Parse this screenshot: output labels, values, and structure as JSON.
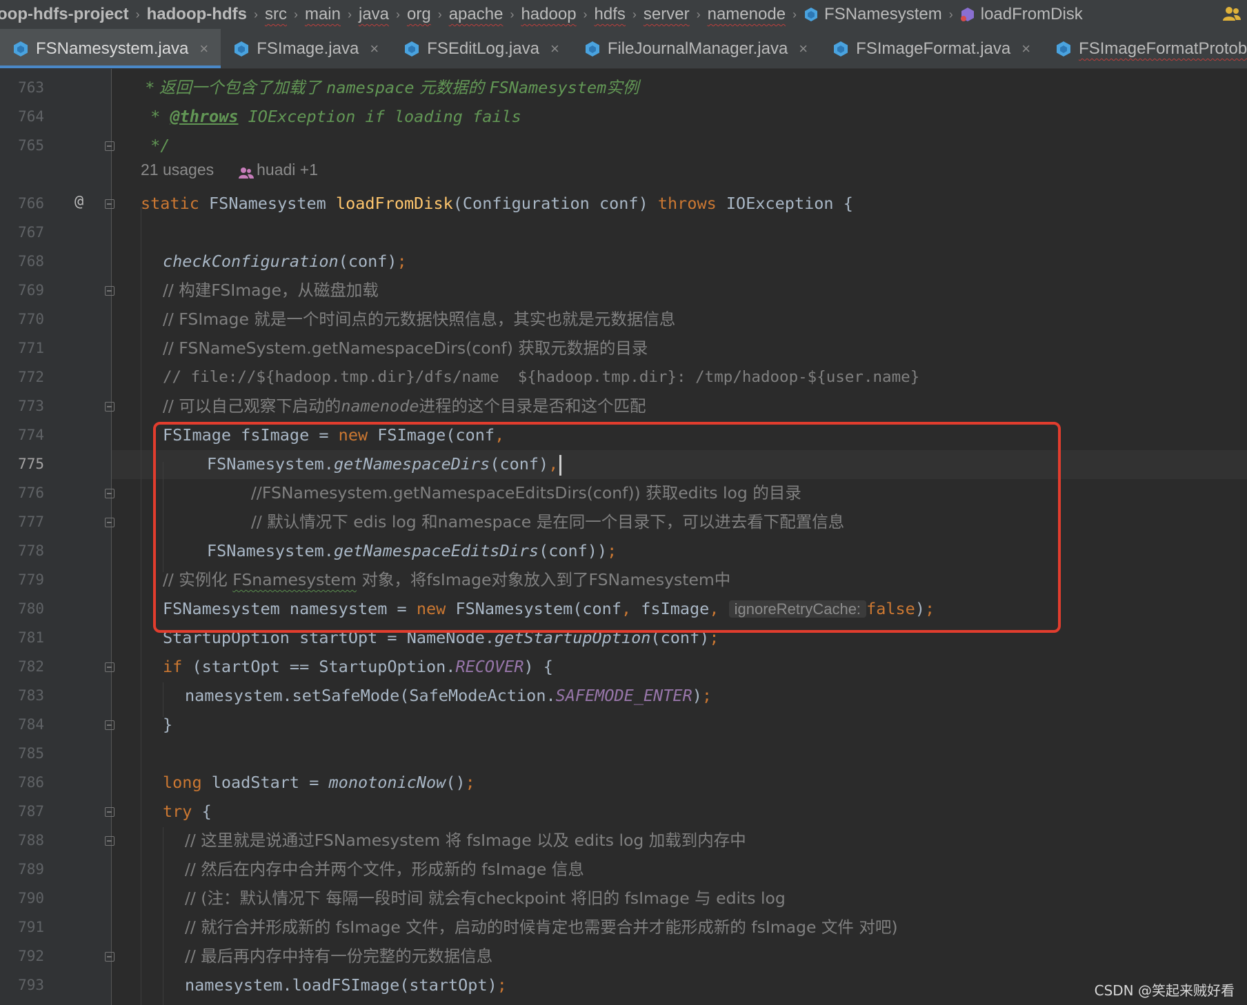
{
  "breadcrumb": {
    "items": [
      {
        "label": "oop-hdfs-project",
        "bold": true
      },
      {
        "label": "hadoop-hdfs",
        "bold": true
      },
      {
        "label": "src"
      },
      {
        "label": "main"
      },
      {
        "label": "java"
      },
      {
        "label": "org"
      },
      {
        "label": "apache"
      },
      {
        "label": "hadoop"
      },
      {
        "label": "hdfs"
      },
      {
        "label": "server"
      },
      {
        "label": "namenode"
      },
      {
        "label": "FSNamesystem",
        "icon": "class-icon"
      },
      {
        "label": "loadFromDisk",
        "icon": "method-icon"
      }
    ],
    "separator": "›"
  },
  "tabs": [
    {
      "label": "FSNamesystem.java",
      "active": true
    },
    {
      "label": "FSImage.java"
    },
    {
      "label": "FSEditLog.java"
    },
    {
      "label": "FileJournalManager.java"
    },
    {
      "label": "FSImageFormat.java"
    },
    {
      "label": "FSImageFormatProtobuf.ja"
    }
  ],
  "tab_close": "×",
  "editor": {
    "line_numbers": [
      "763",
      "764",
      "765",
      "766",
      "767",
      "768",
      "769",
      "770",
      "771",
      "772",
      "773",
      "774",
      "775",
      "776",
      "777",
      "778",
      "779",
      "780",
      "781",
      "782",
      "783",
      "784",
      "785",
      "786",
      "787",
      "788",
      "789",
      "790",
      "791",
      "792",
      "793"
    ],
    "current_line": "775",
    "gutter_annotation": "@",
    "usages": "21 usages",
    "authors": "huadi +1",
    "inlay_hint": "ignoreRetryCache:",
    "lines": {
      "l763_a": " * 返回一个包含了加载了 ",
      "l763_b": "namespace",
      "l763_c": " 元数据的 ",
      "l763_d": "FSNamesystem",
      "l763_e": "实例",
      "l764_a": " * ",
      "l764_tag": "@throws",
      "l764_b": " IOException if loading fails",
      "l765": " */",
      "l766_kw1": "static",
      "l766_type": " FSNamesystem ",
      "l766_fn": "loadFromDisk",
      "l766_params": "(Configuration conf) ",
      "l766_kw2": "throws",
      "l766_rest": " IOException {",
      "l768_fn": "checkConfiguration",
      "l768_rest": "(conf)",
      "l768_semi": ";",
      "l769": "// 构建FSImage，从磁盘加载",
      "l770": "// FSImage 就是一个时间点的元数据快照信息，其实也就是元数据信息",
      "l771": "// FSNameSystem.getNamespaceDirs(conf) 获取元数据的目录",
      "l772": "// file://${hadoop.tmp.dir}/dfs/name  ${hadoop.tmp.dir}: /tmp/hadoop-${user.name}",
      "l773_a": "// 可以自己观察下启动的",
      "l773_b": "namenode",
      "l773_c": "进程的这个目录是否和这个匹配",
      "l774_a": "FSImage fsImage = ",
      "l774_kw": "new",
      "l774_b": " FSImage(conf",
      "l774_c": ",",
      "l775_a": "FSNamesystem.",
      "l775_fn": "getNamespaceDirs",
      "l775_b": "(conf)",
      "l775_c": ",",
      "l776": "//FSNamesystem.getNamespaceEditsDirs(conf)) 获取edits log 的目录",
      "l777": "// 默认情况下 edis log 和namespace 是在同一个目录下，可以进去看下配置信息",
      "l778_a": "FSNamesystem.",
      "l778_fn": "getNamespaceEditsDirs",
      "l778_b": "(conf))",
      "l778_c": ";",
      "l779_a": "// 实例化 ",
      "l779_b": "FSnamesystem",
      "l779_c": " 对象，将fsImage对象放入到了FSNamesystem中",
      "l780_a": "FSNamesystem namesystem = ",
      "l780_kw": "new",
      "l780_b": " FSNamesystem(conf",
      "l780_c": ", ",
      "l780_d": "fsImage",
      "l780_e": ", ",
      "l780_false": "false",
      "l780_end": ")",
      "l780_semi": ";",
      "l781_a": "StartupOption startOpt = NameNode.",
      "l781_fn": "getStartupOption",
      "l781_b": "(conf)",
      "l781_semi": ";",
      "l782_kw": "if",
      "l782_a": " (startOpt == StartupOption.",
      "l782_const": "RECOVER",
      "l782_b": ") {",
      "l783_a": "namesystem.setSafeMode(SafeModeAction.",
      "l783_const": "SAFEMODE_ENTER",
      "l783_b": ")",
      "l783_semi": ";",
      "l784": "}",
      "l786_kw": "long",
      "l786_a": " loadStart = ",
      "l786_fn": "monotonicNow",
      "l786_b": "()",
      "l786_semi": ";",
      "l787_kw": "try",
      "l787_a": " {",
      "l788": "// 这里就是说通过FSNamesystem 将 fsImage 以及 edits log 加载到内存中",
      "l789": "// 然后在内存中合并两个文件，形成新的 fsImage 信息",
      "l790": "// (注：默认情况下 每隔一段时间 就会有checkpoint 将旧的 fsImage 与 edits log",
      "l791": "// 就行合并形成新的 fsImage 文件，启动的时候肯定也需要合并才能形成新的 fsImage 文件 对吧)",
      "l792": "// 最后再内存中持有一份完整的元数据信息",
      "l793_a": "namesystem.loadFSImage(startOpt)",
      "l793_semi": ";"
    }
  },
  "watermark": "CSDN @笑起来贼好看",
  "colors": {
    "highlight_box": "#e23d2e",
    "keyword": "#cc7832",
    "method": "#ffc66d",
    "comment": "#808080",
    "doc_comment": "#629755",
    "constant": "#9876aa",
    "active_tab_underline": "#4a88c7"
  }
}
